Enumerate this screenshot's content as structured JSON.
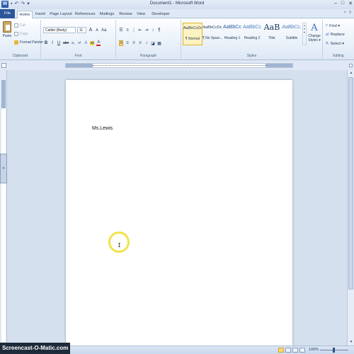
{
  "window": {
    "title": "Document1 - Microsoft Word",
    "min": "–",
    "max": "□",
    "close": "✕",
    "help": "?",
    "ribbon_min": "^"
  },
  "qat": {
    "logo": "W",
    "save": "▪",
    "undo": "↶",
    "redo": "↷",
    "more": "▾"
  },
  "tabs": [
    "File",
    "Home",
    "Insert",
    "Page Layout",
    "References",
    "Mailings",
    "Review",
    "View",
    "Developer"
  ],
  "clipboard": {
    "paste": "Paste",
    "cut": "Cut",
    "copy": "Copy",
    "format_painter": "Format Painter",
    "label": "Clipboard"
  },
  "font": {
    "name": "Calibri (Body)",
    "size": "11",
    "grow": "A",
    "shrink": "A",
    "case": "Aa",
    "bold": "B",
    "italic": "I",
    "underline": "U",
    "strike": "abe",
    "sub": "x₂",
    "sup": "x²",
    "effects": "A",
    "highlight": "ab",
    "color": "A",
    "label": "Font"
  },
  "paragraph": {
    "label": "Paragraph",
    "pilcrow": "¶"
  },
  "styles": {
    "label": "Styles",
    "items": [
      {
        "sample": "AaBbCcDc",
        "name": "¶ Normal"
      },
      {
        "sample": "AaBbCcDc",
        "name": "¶ No Spaci..."
      },
      {
        "sample": "AaBbCc",
        "name": "Heading 1"
      },
      {
        "sample": "AaBbCc",
        "name": "Heading 2"
      },
      {
        "sample": "AaB",
        "name": "Title"
      },
      {
        "sample": "AaBbCc.",
        "name": "Subtitle"
      }
    ],
    "change_styles_1": "Change",
    "change_styles_2": "Styles ▾",
    "change_icon": "A"
  },
  "editing": {
    "label": "Editing",
    "find": "Find ▾",
    "replace": "Replace",
    "select": "Select ▾"
  },
  "document": {
    "text": "Ms.Lewis",
    "ibeam": "I"
  },
  "side_handle": "»",
  "scroll": {
    "up": "▲",
    "down": "▼"
  },
  "status": {
    "watermark": "Screencast-O-Matic.com",
    "zoom": "100%",
    "zoom_out": "–",
    "zoom_in": "+"
  },
  "colors": {
    "file_tab": "#2b579a",
    "highlight": "#f7d74a",
    "font_color": "#d0212a",
    "selection": "#f8d77a",
    "cursor_ring": "#f0e34a"
  }
}
